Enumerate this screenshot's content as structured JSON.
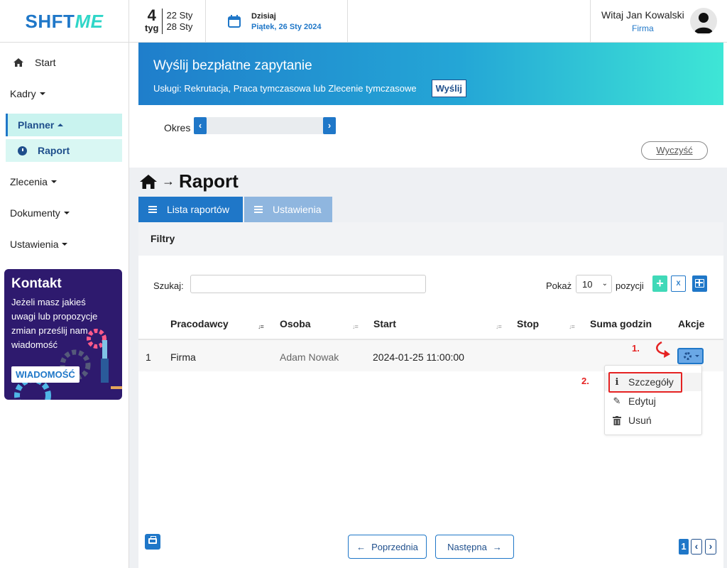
{
  "app": {
    "logo_part1": "SHFT",
    "logo_part2": "ME"
  },
  "header": {
    "week_number": "4",
    "week_label": "tyg",
    "week_start": "22 Sty",
    "week_end": "28 Sty",
    "today_label": "Dzisiaj",
    "today_date": "Piątek, 26 Sty 2024",
    "greeting": "Witaj Jan Kowalski",
    "company": "Firma"
  },
  "sidebar": {
    "start": "Start",
    "kadry": "Kadry",
    "planner": "Planner",
    "raport": "Raport",
    "zlecenia": "Zlecenia",
    "dokumenty": "Dokumenty",
    "ustawienia": "Ustawienia",
    "contact": {
      "title": "Kontakt",
      "text": "Jeżeli masz jakieś uwagi lub propozycje zmian prześlij nam wiadomość",
      "button": "WIADOMOŚĆ"
    }
  },
  "banner": {
    "title": "Wyślij bezpłatne zapytanie",
    "subtitle": "Usługi: Rekrutacja, Praca tymczasowa lub Zlecenie tymczasowe",
    "button": "Wyślij"
  },
  "filters": {
    "okres_label": "Okres",
    "clear": "Wyczyść"
  },
  "page": {
    "title": "Raport",
    "tabs": [
      "Lista raportów",
      "Ustawienia"
    ],
    "filtry": "Filtry",
    "search_label": "Szukaj:",
    "show_label": "Pokaż",
    "show_value": "10",
    "positions_label": "pozycji",
    "xls_label": "X"
  },
  "table": {
    "headers": [
      "Pracodawcy",
      "Osoba",
      "Start",
      "Stop",
      "Suma godzin",
      "Akcje"
    ],
    "rows": [
      {
        "index": "1",
        "employer": "Firma",
        "person": "Adam Nowak",
        "start": "2024-01-25 11:00:00",
        "stop": "",
        "hours": ""
      }
    ]
  },
  "actions_menu": {
    "items": [
      "Szczegóły",
      "Edytuj",
      "Usuń"
    ]
  },
  "annotations": {
    "step1": "1.",
    "step2": "2."
  },
  "pagination": {
    "prev": "Poprzednia",
    "next": "Następna",
    "current_page": "1"
  },
  "colors": {
    "primary": "#1f77c8",
    "accent_teal": "#3ee6d6",
    "annotation_red": "#e52222",
    "contact_bg": "#2e1a6e"
  }
}
